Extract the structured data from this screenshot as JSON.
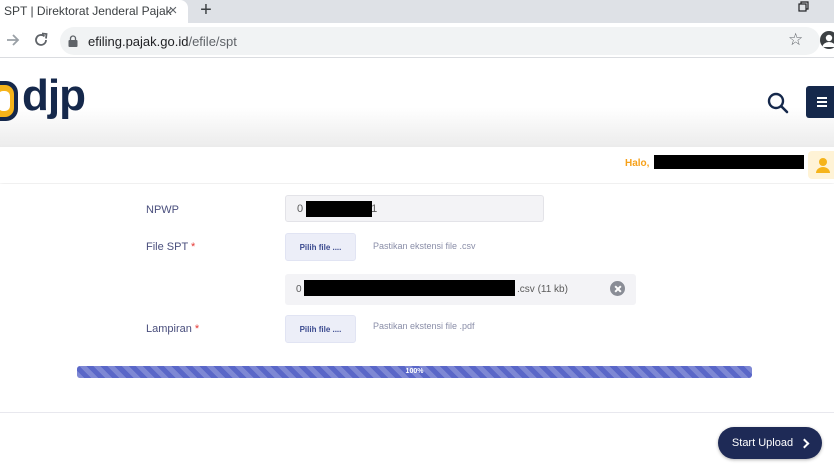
{
  "browser": {
    "tab_title": "SPT | Direktorat Jenderal Pajak",
    "tab_close_glyph": "×",
    "new_tab_glyph": "+",
    "url_host": "efiling.pajak.go.id",
    "url_path": "/efile/spt",
    "bookmark_glyph": "☆"
  },
  "header": {
    "logo_text": "djp",
    "brand_colors": {
      "navy": "#15284b",
      "gold": "#f6b41a"
    },
    "icons": [
      "search-icon",
      "hamburger-menu-icon"
    ]
  },
  "userbar": {
    "greeting": "Halo,",
    "accent": "#f6a11a"
  },
  "form": {
    "npwp_label": "NPWP",
    "npwp_value_prefix": "0",
    "npwp_value_suffix": "1",
    "file_spt_label": "File SPT",
    "required_mark": "*",
    "choose_file_label": "Pilih file ....",
    "csv_hint": "Pastikan ekstensi file .csv",
    "uploaded_file_prefix": "0",
    "uploaded_file_ext": ".csv",
    "uploaded_file_size": "(11 kb)",
    "lampiran_label": "Lampiran",
    "pdf_hint": "Pastikan ekstensi file .pdf"
  },
  "upload": {
    "progress_percent": 100,
    "progress_text": "100%",
    "start_button_label": "Start Upload"
  }
}
